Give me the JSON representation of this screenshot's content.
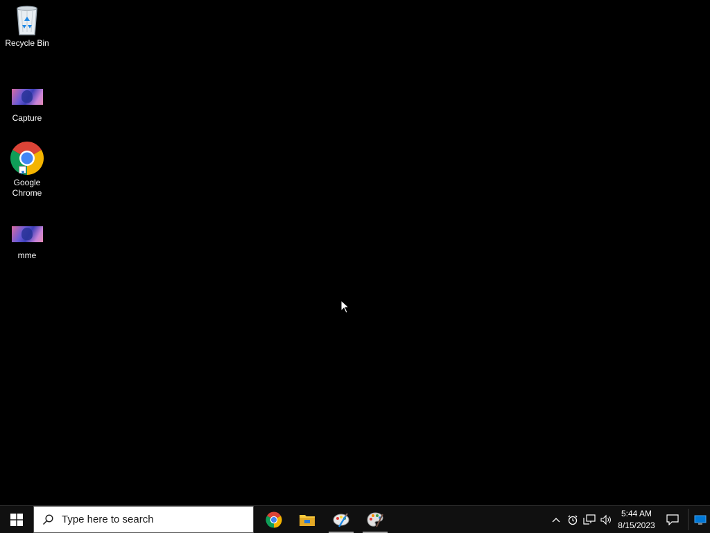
{
  "desktop": {
    "icons": [
      {
        "id": "recycle",
        "label": "Recycle Bin",
        "icon": "recycle-bin-icon"
      },
      {
        "id": "capture",
        "label": "Capture",
        "icon": "image-thumbnail-icon"
      },
      {
        "id": "chrome",
        "label": "Google\nChrome",
        "icon": "chrome-icon"
      },
      {
        "id": "mme",
        "label": "mme",
        "icon": "image-thumbnail-icon"
      }
    ]
  },
  "taskbar": {
    "search_placeholder": "Type here to search",
    "pinned_apps": [
      {
        "name": "Google Chrome",
        "icon": "chrome-icon",
        "active": false
      },
      {
        "name": "File Explorer",
        "icon": "folder-icon",
        "active": false
      },
      {
        "name": "Paint",
        "icon": "paint-icon",
        "active": true
      },
      {
        "name": "Paint 3D",
        "icon": "palette-icon",
        "active": true
      }
    ],
    "tray": {
      "icons": [
        "chevron-up-icon",
        "recorder-icon",
        "network-icon",
        "volume-icon"
      ],
      "time": "5:44 AM",
      "date": "8/15/2023"
    },
    "colors": {
      "background": "#101010",
      "accent": "#0078d7"
    }
  }
}
